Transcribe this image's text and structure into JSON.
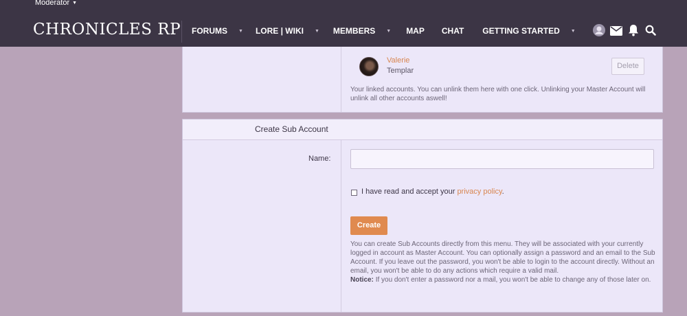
{
  "topbar": {
    "moderator_label": "Moderator",
    "logo": "CHRONICLES RP",
    "nav": [
      {
        "label": "FORUMS",
        "has_dropdown": true
      },
      {
        "label": "LORE | WIKI",
        "has_dropdown": true
      },
      {
        "label": "MEMBERS",
        "has_dropdown": true
      },
      {
        "label": "MAP",
        "has_dropdown": false
      },
      {
        "label": "CHAT",
        "has_dropdown": false
      },
      {
        "label": "GETTING STARTED",
        "has_dropdown": true
      }
    ],
    "icons": [
      "avatar-icon",
      "mail-icon",
      "bell-icon",
      "search-icon"
    ]
  },
  "linked_accounts": {
    "account": {
      "name": "Valerie",
      "role": "Templar"
    },
    "delete_label": "Delete",
    "hint": "Your linked accounts. You can unlink them here with one click. Unlinking your Master Account will unlink all other accounts aswell!"
  },
  "create_sub": {
    "title": "Create Sub Account",
    "name_label": "Name:",
    "name_value": "",
    "policy_text": "I have read and accept your",
    "policy_link": "privacy policy",
    "policy_end": ".",
    "button": "Create",
    "hint": "You can create Sub Accounts directly from this menu. They will be associated with your currently logged in account as Master Account. You can optionally assign a password and an email to the Sub Account. If you leave out the password, you won't be able to login to the account directly. Without an email, you won't be able to do any actions which require a valid mail.",
    "notice_label": "Notice:",
    "notice_text": "If you don't enter a password nor a mail, you won't be able to change any of those later on."
  },
  "colors": {
    "topbar": "#3c3545",
    "background": "#b8a3b8",
    "panel": "#ece7f9",
    "accent": "#e08a4f",
    "link": "#d88650"
  }
}
